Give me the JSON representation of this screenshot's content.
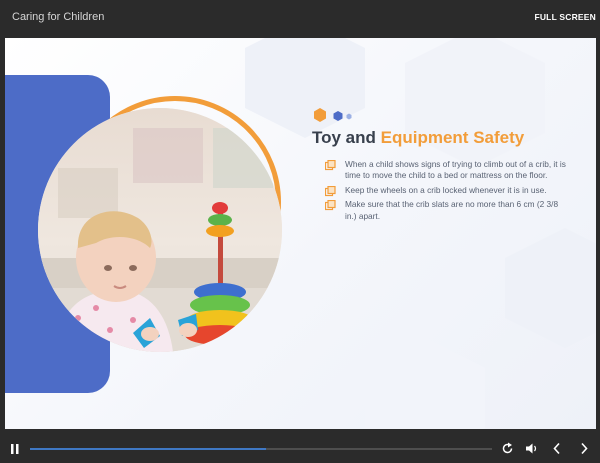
{
  "header": {
    "title": "Caring for Children",
    "fullscreen_label": "FULL SCREEN"
  },
  "slide": {
    "heading_part1": "Toy and ",
    "heading_part2": "Equipment Safety",
    "bullets": [
      "When a child shows signs of trying to climb out of a crib, it is time to move the child to a bed or mattress on the floor.",
      "Keep the wheels on a crib locked whenever it is in use.",
      "Make sure that the crib slats are no more than 6 cm (2 3/8 in.) apart."
    ],
    "icons": [
      "hexagon-orange-icon",
      "hexagon-blue-icon",
      "hexagon-light-blue-icon",
      "copy-icon"
    ],
    "image": "baby-playing-with-toys-photo"
  },
  "player": {
    "progress": 0.51,
    "icons": [
      "pause-icon",
      "replay-icon",
      "volume-icon",
      "previous-icon",
      "next-icon"
    ]
  },
  "colors": {
    "accent_orange": "#f29d3a",
    "brand_blue": "#4d6cc7",
    "heading_text": "#38404d",
    "body_text": "#596273",
    "chrome_bg": "#2b2b2b",
    "progress_fill": "#3f78c4"
  }
}
